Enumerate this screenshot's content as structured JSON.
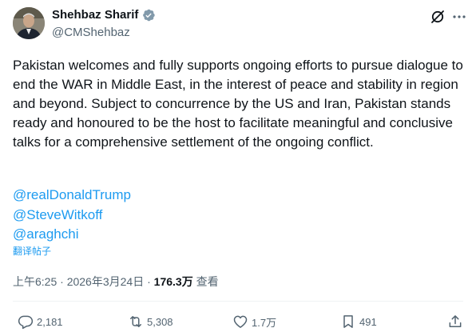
{
  "author": {
    "name": "Shehbaz Sharif",
    "handle": "@CMShehbaz"
  },
  "post": {
    "text": "Pakistan welcomes and fully supports ongoing efforts to pursue dialogue to end the WAR in Middle East, in the interest of peace and stability in region and beyond. Subject to concurrence by the US and Iran, Pakistan stands ready and honoured to be the host to facilitate meaningful and conclusive talks for a comprehensive settlement of the ongoing conflict.",
    "mentions": [
      "@realDonaldTrump",
      "@SteveWitkoff",
      "@araghchi"
    ],
    "translate_label": "翻译帖子",
    "time": "上午6:25",
    "separator": " · ",
    "date": "2026年3月24日",
    "views_count": "176.3万",
    "views_label": " 查看"
  },
  "actions": {
    "replies": "2,181",
    "reposts": "5,308",
    "likes": "1.7万",
    "bookmarks": "491"
  },
  "icons": [
    "verified-badge-icon",
    "grok-icon",
    "more-icon",
    "reply-icon",
    "repost-icon",
    "like-icon",
    "bookmark-icon",
    "share-icon"
  ],
  "colors": {
    "accent": "#1d9bf0",
    "secondary_text": "#536471",
    "primary_text": "#0f1419"
  }
}
